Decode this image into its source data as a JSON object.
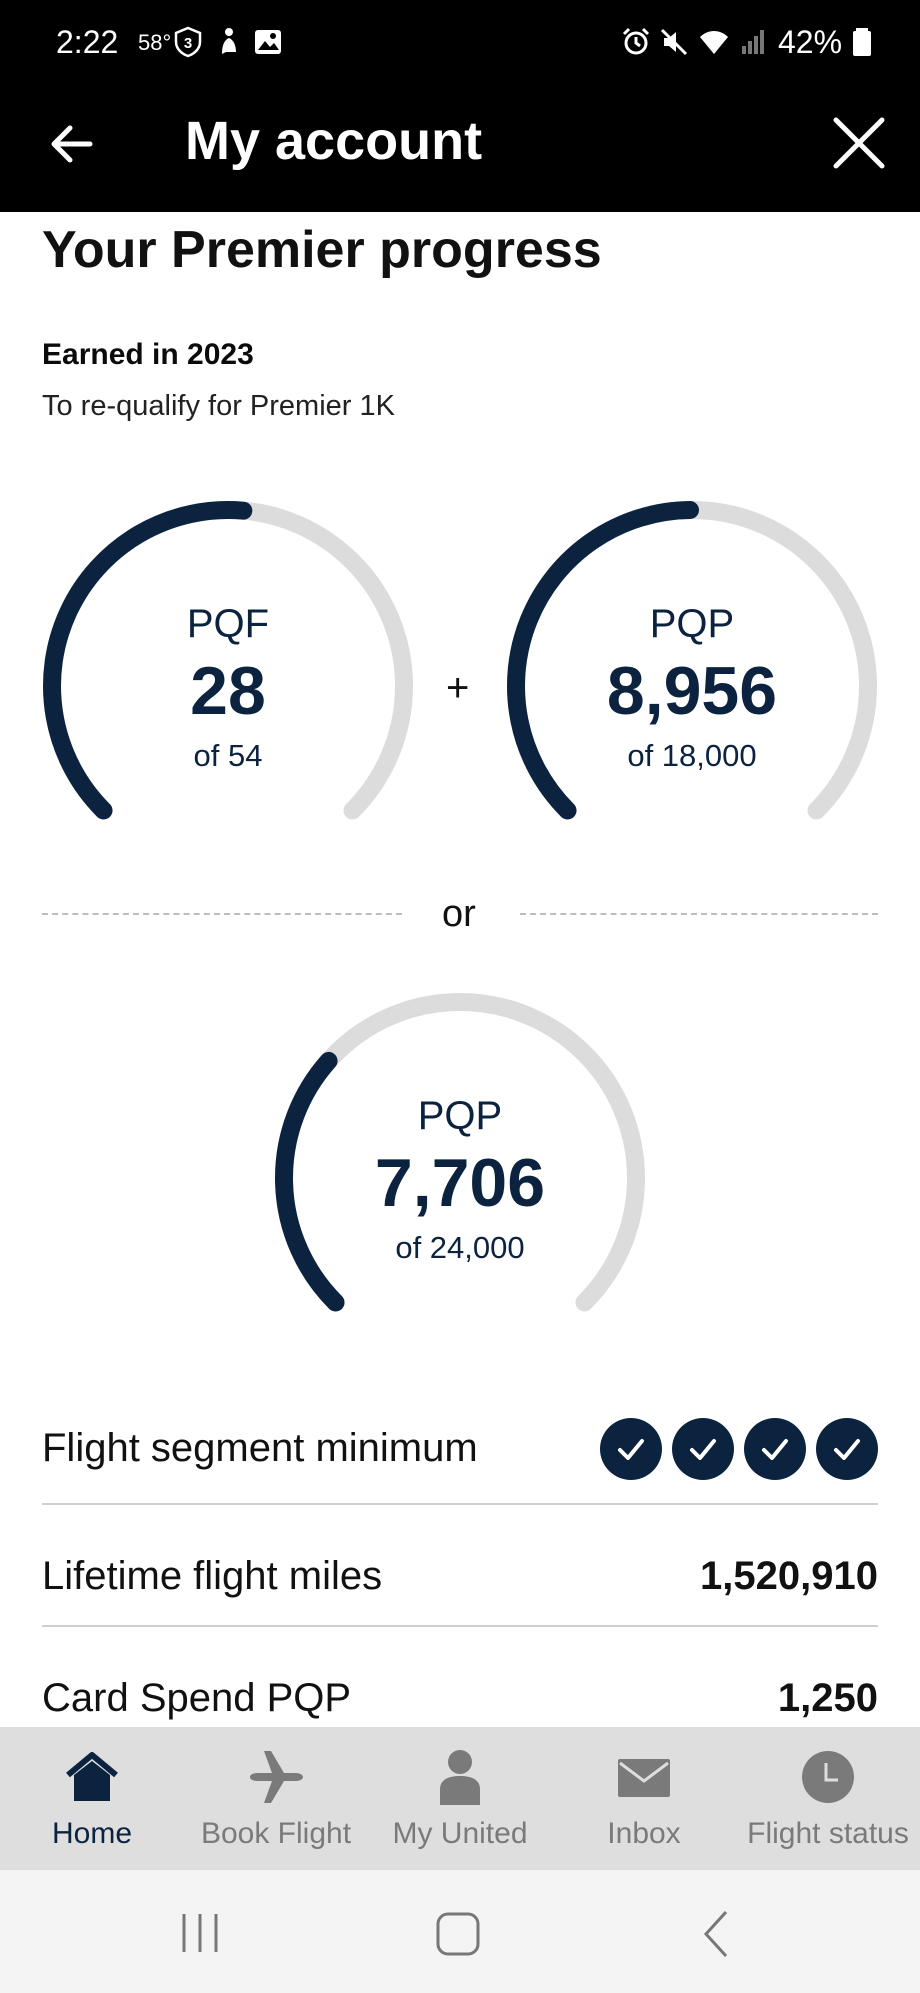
{
  "status_bar": {
    "time": "2:22",
    "temperature": "58°",
    "battery": "42%",
    "icons": [
      "shield-3-icon",
      "figure-icon",
      "image-icon",
      "alarm-icon",
      "mute-icon",
      "wifi-icon",
      "signal-icon",
      "battery-icon"
    ]
  },
  "header": {
    "title": "My account",
    "back_icon": "arrow-left-icon",
    "close_icon": "close-icon"
  },
  "progress": {
    "title": "Your Premier progress",
    "earned_label": "Earned in 2023",
    "requalify_text": "To re-qualify for Premier 1K",
    "plus": "+",
    "or": "or",
    "gauges": [
      {
        "label": "PQF",
        "value": "28",
        "of": "of 54",
        "fraction": 0.5185
      },
      {
        "label": "PQP",
        "value": "8,956",
        "of": "of 18,000",
        "fraction": 0.4976
      },
      {
        "label": "PQP",
        "value": "7,706",
        "of": "of 24,000",
        "fraction": 0.3211
      }
    ]
  },
  "stats": {
    "segment_label": "Flight segment minimum",
    "segment_checks": 4,
    "lifetime_label": "Lifetime flight miles",
    "lifetime_value": "1,520,910",
    "card_label": "Card Spend PQP",
    "card_value": "1,250"
  },
  "tabs": [
    {
      "label": "Home",
      "icon": "home-icon",
      "active": true
    },
    {
      "label": "Book Flight",
      "icon": "airplane-icon",
      "active": false
    },
    {
      "label": "My United",
      "icon": "person-icon",
      "active": false
    },
    {
      "label": "Inbox",
      "icon": "envelope-icon",
      "active": false
    },
    {
      "label": "Flight status",
      "icon": "clock-icon",
      "active": false
    }
  ],
  "colors": {
    "accent": "#0c2340",
    "track": "#dcdcdc",
    "tabbar": "#dedede",
    "inactive_tab": "#7a7a7a"
  }
}
